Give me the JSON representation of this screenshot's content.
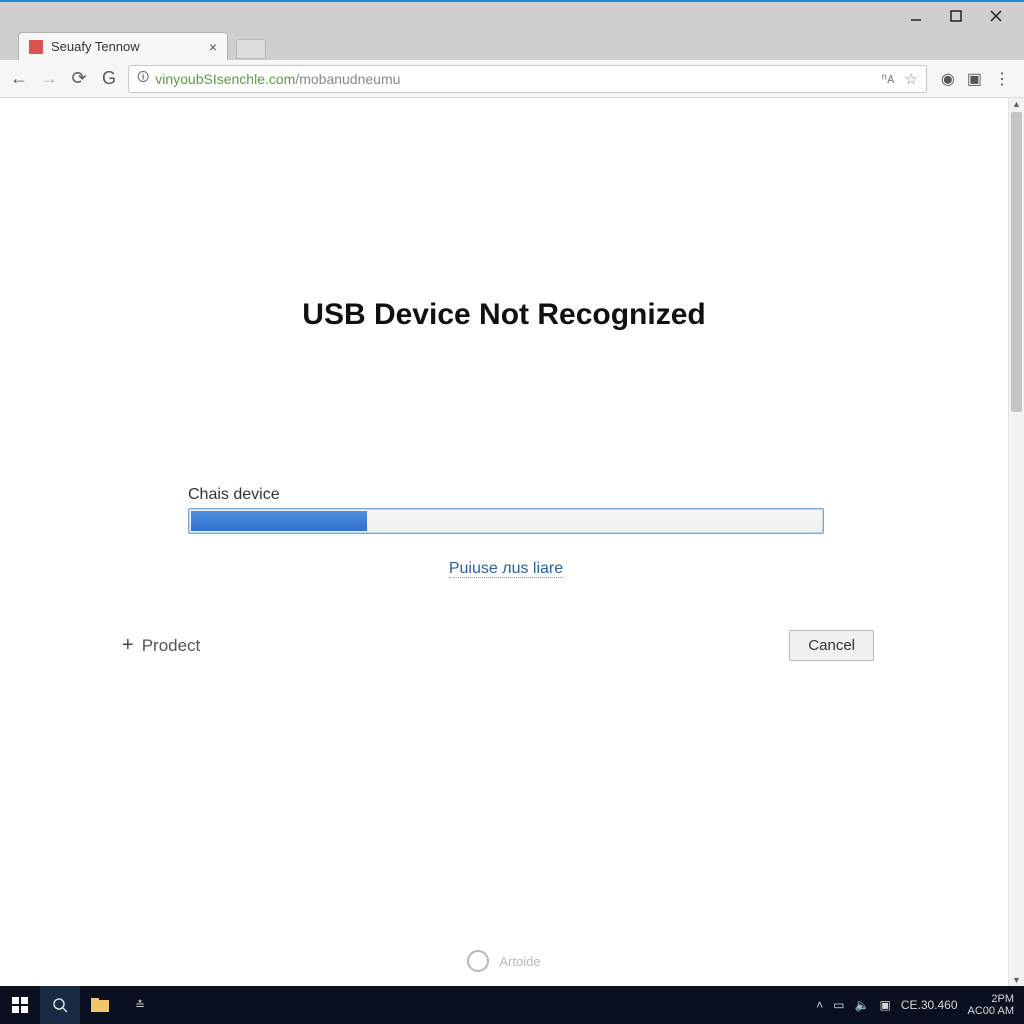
{
  "window": {
    "tab_title": "Seuafy Tennow",
    "url_host": "vinyoubSIsenchle.com",
    "url_path": "/mobanudneumu"
  },
  "page": {
    "heading": "USB Device Not Recognized",
    "field_label": "Chais device",
    "progress_percent": 28,
    "link_text": "Puiuse лus liare",
    "add_label": "Prodect",
    "cancel_label": "Cancel",
    "spinner_label": "Artoide"
  },
  "taskbar": {
    "tray_text": "CE.30.460",
    "clock_line1": "2PM",
    "clock_line2": "AC00 AM"
  }
}
